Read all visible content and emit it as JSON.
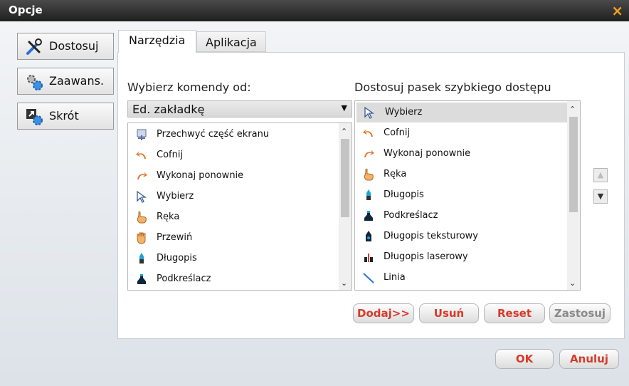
{
  "window": {
    "title": "Opcje",
    "close_glyph": "×"
  },
  "sidebar": {
    "items": [
      {
        "label": "Dostosuj",
        "icon": "tools-icon"
      },
      {
        "label": "Zaawans.",
        "icon": "gears-icon"
      },
      {
        "label": "Skrót",
        "icon": "shortcut-gear-icon"
      }
    ]
  },
  "tabs": [
    {
      "label": "Narzędzia",
      "active": true
    },
    {
      "label": "Aplikacja",
      "active": false
    }
  ],
  "left_panel": {
    "caption": "Wybierz komendy od:",
    "select_value": "Ed. zakładkę",
    "items": [
      {
        "label": "Przechwyć część ekranu",
        "icon": "screen-capture-icon"
      },
      {
        "label": "Cofnij",
        "icon": "undo-icon"
      },
      {
        "label": "Wykonaj ponownie",
        "icon": "redo-icon"
      },
      {
        "label": "Wybierz",
        "icon": "select-cursor-icon"
      },
      {
        "label": "Ręka",
        "icon": "hand-icon"
      },
      {
        "label": "Przewiń",
        "icon": "scroll-hand-icon"
      },
      {
        "label": "Długopis",
        "icon": "pen-icon"
      },
      {
        "label": "Podkreślacz",
        "icon": "highlighter-icon"
      }
    ]
  },
  "right_panel": {
    "caption": "Dostosuj pasek szybkiego dostępu",
    "items": [
      {
        "label": "Wybierz",
        "icon": "select-cursor-icon",
        "selected": true
      },
      {
        "label": "Cofnij",
        "icon": "undo-icon"
      },
      {
        "label": "Wykonaj ponownie",
        "icon": "redo-icon"
      },
      {
        "label": "Ręka",
        "icon": "hand-icon"
      },
      {
        "label": "Długopis",
        "icon": "pen-icon"
      },
      {
        "label": "Podkreślacz",
        "icon": "highlighter-icon"
      },
      {
        "label": "Długopis teksturowy",
        "icon": "texture-pen-icon"
      },
      {
        "label": "Długopis laserowy",
        "icon": "laser-pen-icon"
      },
      {
        "label": "Linia",
        "icon": "line-icon"
      }
    ]
  },
  "actions": {
    "add": "Dodaj>>",
    "remove": "Usuń",
    "reset": "Reset",
    "apply": "Zastosuj"
  },
  "footer": {
    "ok": "OK",
    "cancel": "Anuluj"
  },
  "colors": {
    "accent": "#d83a2a",
    "close": "#f0a020"
  }
}
